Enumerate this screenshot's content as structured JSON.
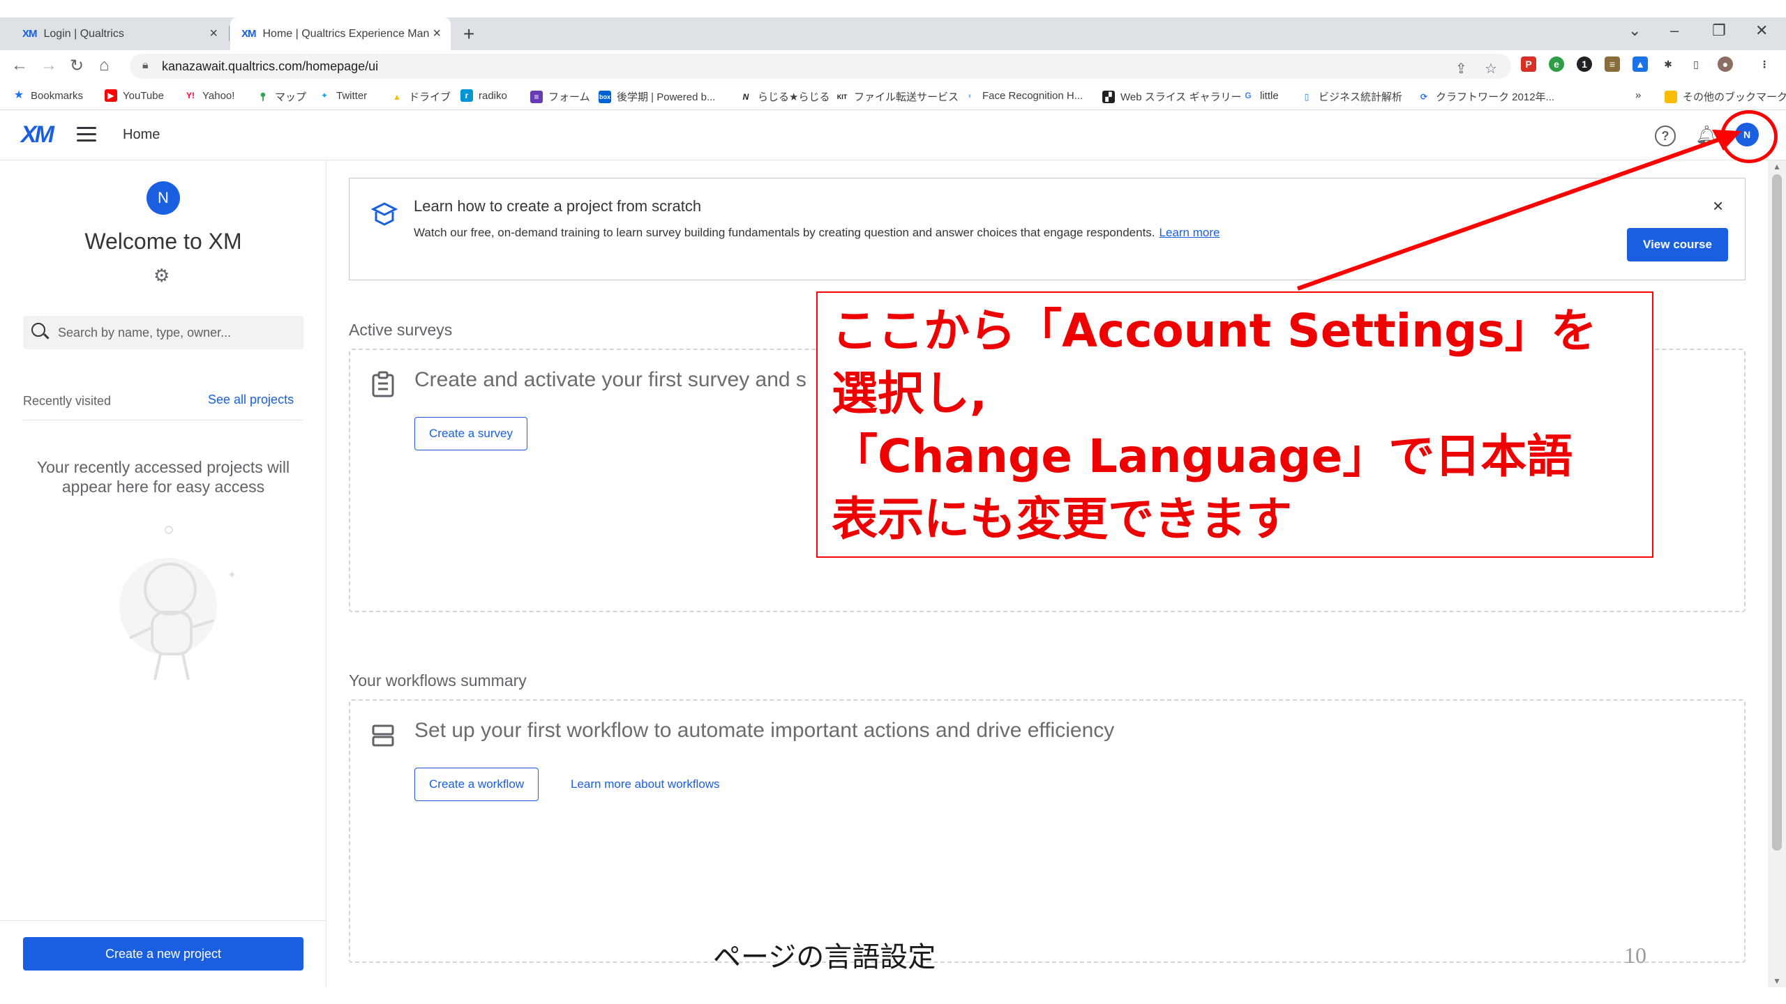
{
  "browser": {
    "tabs": [
      {
        "favicon": "XM",
        "label": "Login | Qualtrics"
      },
      {
        "favicon": "XM",
        "label": "Home | Qualtrics Experience Man"
      }
    ],
    "url": "kanazawait.qualtrics.com/homepage/ui",
    "bookmarks": [
      {
        "icon": "star-icon",
        "label": "Bookmarks"
      },
      {
        "icon": "youtube-icon",
        "label": "YouTube"
      },
      {
        "icon": "yahoo-icon",
        "label": "Yahoo!"
      },
      {
        "icon": "maps-pin-icon",
        "label": "マップ"
      },
      {
        "icon": "twitter-icon",
        "label": "Twitter"
      },
      {
        "icon": "drive-icon",
        "label": "ドライブ"
      },
      {
        "icon": "radiko-icon",
        "label": "radiko"
      },
      {
        "icon": "forms-icon",
        "label": "フォーム"
      },
      {
        "icon": "box-icon",
        "label": "後学期 | Powered b..."
      },
      {
        "icon": "radiru-icon",
        "label": "らじる★らじる"
      },
      {
        "icon": "kit-icon",
        "label": "ファイル転送サービス"
      },
      {
        "icon": "face-icon",
        "label": "Face Recognition H..."
      },
      {
        "icon": "web-slice-icon",
        "label": "Web スライス ギャラリー"
      },
      {
        "icon": "google-icon",
        "label": "little"
      },
      {
        "icon": "doc-icon",
        "label": "ビジネス統計解析"
      },
      {
        "icon": "craft-icon",
        "label": "クラフトワーク 2012年..."
      }
    ],
    "bookmarks_more": "»",
    "other_bookmarks": "その他のブックマーク"
  },
  "header": {
    "logo": "XM",
    "title": "Home",
    "avatar_initial": "N"
  },
  "sidebar": {
    "avatar_initial": "N",
    "welcome": "Welcome to XM",
    "search_placeholder": "Search by name, type, owner...",
    "recent_label": "Recently visited",
    "see_all": "See all projects",
    "empty_line1": "Your recently accessed projects will",
    "empty_line2": "appear here for easy access",
    "create_project": "Create a new project"
  },
  "banner": {
    "title": "Learn how to create a project from scratch",
    "description": "Watch our free, on-demand training to learn survey building fundamentals by creating question and answer choices that engage respondents.",
    "learn_more": "Learn more",
    "close": "×",
    "view_course": "View course"
  },
  "active_surveys": {
    "title": "Active surveys",
    "heading": "Create and activate your first survey and s",
    "create_button": "Create a survey"
  },
  "workflows": {
    "title": "Your workflows summary",
    "heading": "Set up your first workflow to automate important actions and drive efficiency",
    "create_button": "Create a workflow",
    "learn_more": "Learn more about workflows"
  },
  "annotation": {
    "line1": "ここから「Account Settings」を",
    "line2": "選択し,",
    "line3": "「Change Language」で日本語",
    "line4": "表示にも変更できます",
    "color": "#ee0000"
  },
  "slide": {
    "footer": "ページの言語設定",
    "page_number": "10"
  },
  "colors": {
    "accent": "#1a5fe0",
    "annotation_red": "#ff0000"
  }
}
